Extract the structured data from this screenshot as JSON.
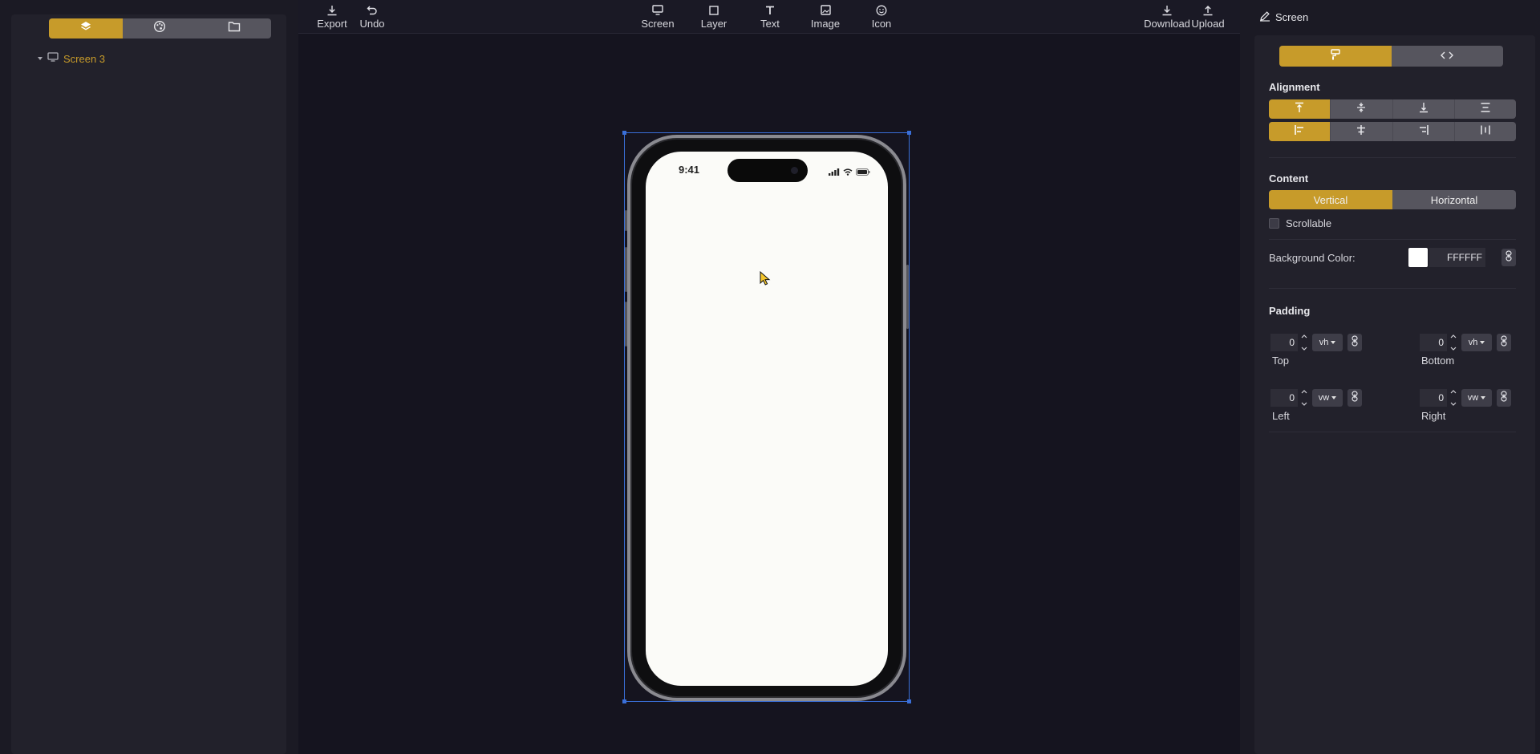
{
  "colors": {
    "accent": "#c79b2a",
    "background": "#15141f",
    "panel": "#1b1a24",
    "selection": "#3a6fd8",
    "phone_screen": "#fbfbf8"
  },
  "left_panel": {
    "tabs": [
      {
        "icon": "layers-icon",
        "active": true
      },
      {
        "icon": "palette-icon",
        "active": false
      },
      {
        "icon": "folder-icon",
        "active": false
      }
    ],
    "tree": {
      "item_label": "Screen 3",
      "icon": "monitor-icon"
    }
  },
  "toolbar": {
    "export": "Export",
    "undo": "Undo",
    "screen": "Screen",
    "layer": "Layer",
    "text": "Text",
    "image": "Image",
    "icon": "Icon",
    "download": "Download",
    "upload": "Upload"
  },
  "phone": {
    "time": "9:41"
  },
  "right_panel": {
    "header_title": "Screen",
    "mode_tabs": [
      {
        "icon": "paint-roller-icon",
        "active": true
      },
      {
        "icon": "code-icon",
        "active": false
      }
    ],
    "alignment_title": "Alignment",
    "content_title": "Content",
    "content_options": {
      "vertical": "Vertical",
      "horizontal": "Horizontal",
      "selected": "Vertical"
    },
    "scrollable_label": "Scrollable",
    "scrollable_checked": false,
    "background_color_label": "Background Color:",
    "background_color_value": "FFFFFF",
    "padding_title": "Padding",
    "padding": {
      "top": {
        "value": "0",
        "unit": "vh",
        "label": "Top"
      },
      "bottom": {
        "value": "0",
        "unit": "vh",
        "label": "Bottom"
      },
      "left": {
        "value": "0",
        "unit": "vw",
        "label": "Left"
      },
      "right": {
        "value": "0",
        "unit": "vw",
        "label": "Right"
      }
    }
  }
}
